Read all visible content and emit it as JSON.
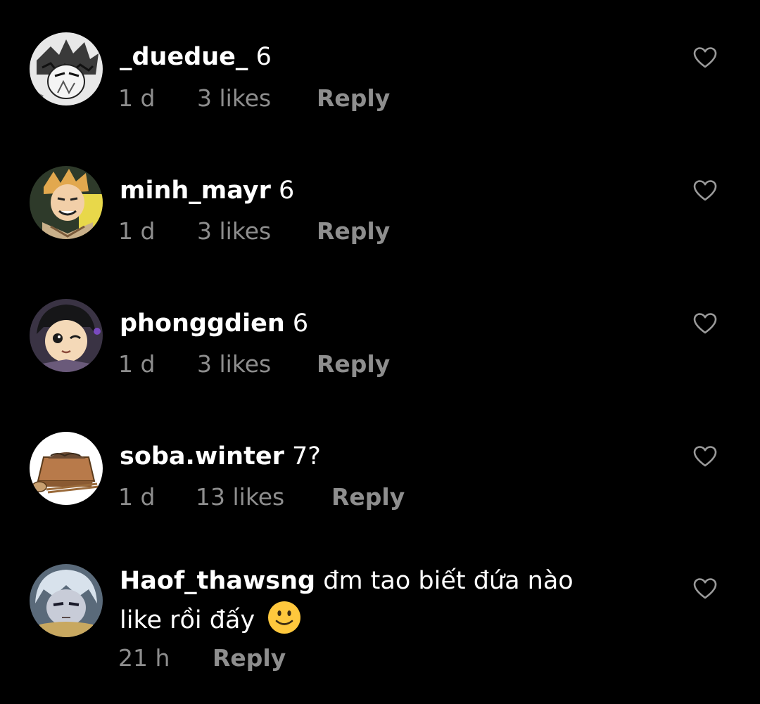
{
  "colors": {
    "background": "#000000",
    "text": "#ffffff",
    "meta": "#8e8e8e",
    "heart_outline": "#9a9a9a",
    "emoji": "#ffc83d"
  },
  "comments": [
    {
      "username": "_duedue_",
      "text": "6",
      "time": "1 d",
      "likes": "3 likes",
      "reply": "Reply",
      "avatar_icon": "manga-character-avatar-icon",
      "like_icon": "heart-outline-icon"
    },
    {
      "username": "minh_mayr",
      "text": "6",
      "time": "1 d",
      "likes": "3 likes",
      "reply": "Reply",
      "avatar_icon": "anime-blond-character-avatar-icon",
      "like_icon": "heart-outline-icon"
    },
    {
      "username": "phonggdien",
      "text": "6",
      "time": "1 d",
      "likes": "3 likes",
      "reply": "Reply",
      "avatar_icon": "anime-winking-character-avatar-icon",
      "like_icon": "heart-outline-icon"
    },
    {
      "username": "soba.winter",
      "text": "7?",
      "time": "1 d",
      "likes": "13 likes",
      "reply": "Reply",
      "avatar_icon": "soba-noodles-avatar-icon",
      "like_icon": "heart-outline-icon"
    },
    {
      "username": "Haof_thawsng",
      "text_line1": "đm tao biết đứa nào",
      "text_line2": "like rồi đấy",
      "emoji": "slightly-smiling-face-icon",
      "time": "21 h",
      "reply": "Reply",
      "avatar_icon": "anime-white-haired-character-avatar-icon",
      "like_icon": "heart-outline-icon"
    }
  ]
}
